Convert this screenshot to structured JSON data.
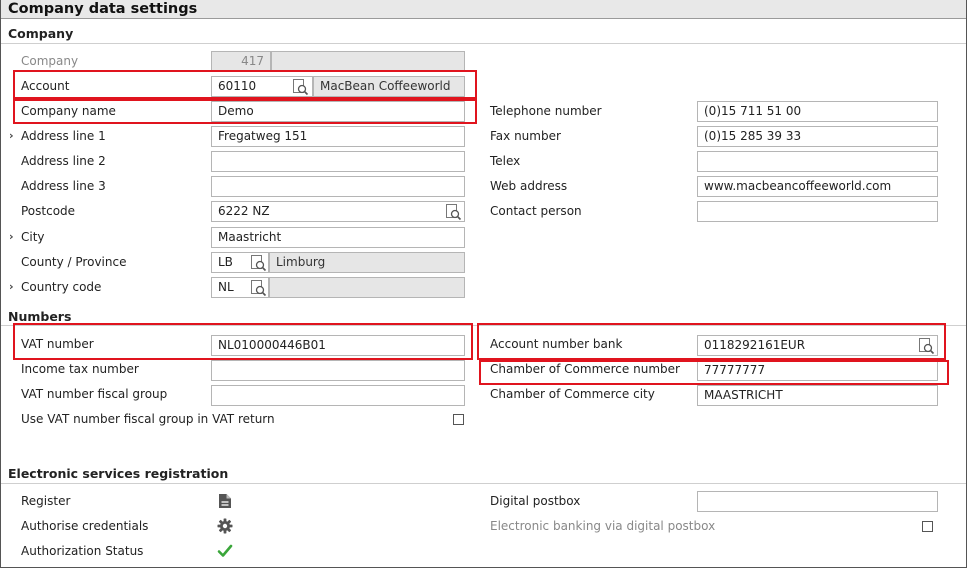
{
  "page": {
    "title": "Company data settings"
  },
  "sections": {
    "company": "Company",
    "numbers": "Numbers",
    "electronic": "Electronic services registration"
  },
  "company": {
    "company_label": "Company",
    "company_value": "417",
    "account_label": "Account",
    "account_code": "60110",
    "account_name": "MacBean Coffeeworld",
    "company_name_label": "Company name",
    "company_name_value": "Demo",
    "address1_label": "Address line 1",
    "address1_value": "Fregatweg 151",
    "address2_label": "Address line 2",
    "address2_value": "",
    "address3_label": "Address line 3",
    "address3_value": "",
    "postcode_label": "Postcode",
    "postcode_value": "6222 NZ",
    "city_label": "City",
    "city_value": "Maastricht",
    "county_label": "County / Province",
    "county_code": "LB",
    "county_name": "Limburg",
    "country_label": "Country code",
    "country_code": "NL",
    "country_name": "",
    "telephone_label": "Telephone number",
    "telephone_value": "(0)15 711 51 00",
    "fax_label": "Fax number",
    "fax_value": "(0)15 285 39 33",
    "telex_label": "Telex",
    "telex_value": "",
    "web_label": "Web address",
    "web_value": "www.macbeancoffeeworld.com",
    "contact_label": "Contact person",
    "contact_value": ""
  },
  "numbers": {
    "vat_label": "VAT number",
    "vat_value": "NL010000446B01",
    "income_tax_label": "Income tax number",
    "income_tax_value": "",
    "vat_fiscal_label": "VAT number fiscal group",
    "vat_fiscal_value": "",
    "use_vat_fiscal_label": "Use VAT number fiscal group in VAT return",
    "use_vat_fiscal_checked": false,
    "bank_label": "Account number bank",
    "bank_value": "0118292161EUR",
    "coc_label": "Chamber of Commerce number",
    "coc_value": "77777777",
    "coc_city_label": "Chamber of Commerce city",
    "coc_city_value": "MAASTRICHT"
  },
  "electronic": {
    "register_label": "Register",
    "authorise_label": "Authorise credentials",
    "status_label": "Authorization Status",
    "digital_postbox_label": "Digital postbox",
    "digital_postbox_value": "",
    "ebanking_label": "Electronic banking via digital postbox",
    "ebanking_checked": false
  },
  "icons": {
    "lookup": "lookup-magnifier-icon",
    "register": "document-icon",
    "authorise": "gear-icon",
    "status": "checkmark-icon",
    "expand": "chevron-right-icon"
  },
  "colors": {
    "highlight": "#e0141e",
    "status_ok": "#3aa63a"
  }
}
